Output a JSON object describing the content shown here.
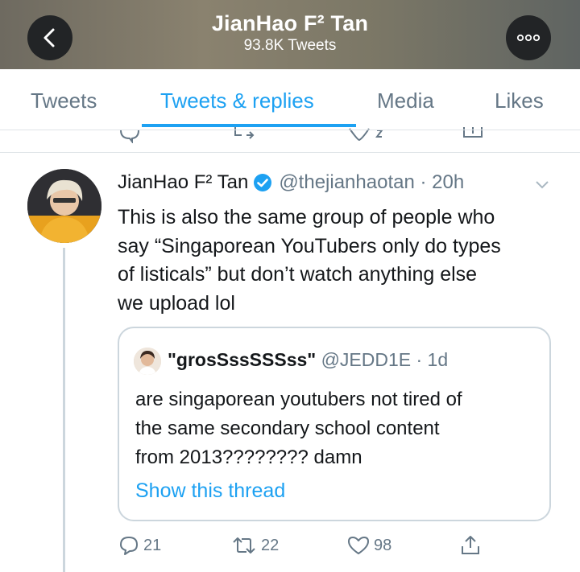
{
  "header": {
    "title": "JianHao F² Tan",
    "subtitle": "93.8K Tweets",
    "background_color": "#7b7666"
  },
  "tabs": [
    {
      "label": "Tweets",
      "active": false
    },
    {
      "label": "Tweets & replies",
      "active": true
    },
    {
      "label": "Media",
      "active": false
    },
    {
      "label": "Likes",
      "active": false
    }
  ],
  "tweet": {
    "name": "JianHao F² Tan",
    "handle_time": "@thejianhaotan · 20h",
    "verified": true,
    "text_lines": [
      "This is also the same group of people who",
      "say “Singaporean YouTubers only do types",
      "of listicals” but don’t watch anything else",
      "we upload lol"
    ],
    "quote": {
      "name": "\"grosSssSSSss\"",
      "handle_time": "@JEDD1E · 1d",
      "text_lines": [
        "are singaporean youtubers not tired of",
        "the same secondary school content",
        "from 2013???????? damn"
      ],
      "link": "Show this thread"
    },
    "actions": {
      "replies": "21",
      "retweets": "22",
      "likes": "98"
    }
  },
  "colors": {
    "accent": "#1da1f2",
    "muted": "#657786",
    "border": "#ccd6dd"
  },
  "icons": [
    "back-arrow-icon",
    "more-icon",
    "verified-icon",
    "chevron-down-icon",
    "reply-icon",
    "retweet-icon",
    "like-icon",
    "share-icon"
  ]
}
